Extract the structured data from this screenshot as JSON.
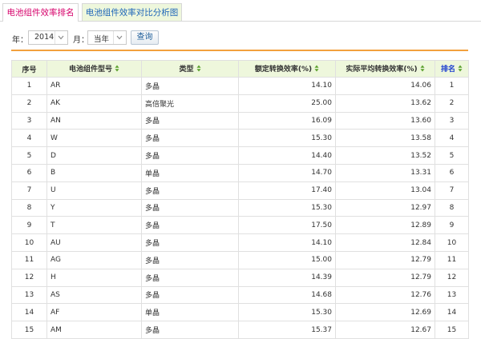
{
  "tabs": [
    {
      "label": "电池组件效率排名",
      "active": true
    },
    {
      "label": "电池组件效率对比分析图",
      "active": false
    }
  ],
  "filters": {
    "year_label": "年：",
    "year_value": "2014",
    "month_label": "月：",
    "month_value": "当年",
    "query_label": "查询"
  },
  "table": {
    "headers": {
      "seq": "序号",
      "model": "电池组件型号",
      "type": "类型",
      "rated": "额定转换效率(%)",
      "actual": "实际平均转换效率(%)",
      "rank": "排名"
    },
    "rows": [
      {
        "seq": "1",
        "model": "AR",
        "type": "多晶",
        "rated": "14.10",
        "actual": "14.06",
        "rank": "1"
      },
      {
        "seq": "2",
        "model": "AK",
        "type": "高倍聚光",
        "rated": "25.00",
        "actual": "13.62",
        "rank": "2"
      },
      {
        "seq": "3",
        "model": "AN",
        "type": "多晶",
        "rated": "16.09",
        "actual": "13.60",
        "rank": "3"
      },
      {
        "seq": "4",
        "model": "W",
        "type": "多晶",
        "rated": "15.30",
        "actual": "13.58",
        "rank": "4"
      },
      {
        "seq": "5",
        "model": "D",
        "type": "多晶",
        "rated": "14.40",
        "actual": "13.52",
        "rank": "5"
      },
      {
        "seq": "6",
        "model": "B",
        "type": "单晶",
        "rated": "14.70",
        "actual": "13.31",
        "rank": "6"
      },
      {
        "seq": "7",
        "model": "U",
        "type": "多晶",
        "rated": "17.40",
        "actual": "13.04",
        "rank": "7"
      },
      {
        "seq": "8",
        "model": "Y",
        "type": "多晶",
        "rated": "15.30",
        "actual": "12.97",
        "rank": "8"
      },
      {
        "seq": "9",
        "model": "T",
        "type": "多晶",
        "rated": "17.50",
        "actual": "12.89",
        "rank": "9"
      },
      {
        "seq": "10",
        "model": "AU",
        "type": "多晶",
        "rated": "14.10",
        "actual": "12.84",
        "rank": "10"
      },
      {
        "seq": "11",
        "model": "AG",
        "type": "多晶",
        "rated": "15.00",
        "actual": "12.79",
        "rank": "11"
      },
      {
        "seq": "12",
        "model": "H",
        "type": "多晶",
        "rated": "14.39",
        "actual": "12.79",
        "rank": "12"
      },
      {
        "seq": "13",
        "model": "AS",
        "type": "多晶",
        "rated": "14.68",
        "actual": "12.76",
        "rank": "13"
      },
      {
        "seq": "14",
        "model": "AF",
        "type": "单晶",
        "rated": "15.30",
        "actual": "12.69",
        "rank": "14"
      },
      {
        "seq": "15",
        "model": "AM",
        "type": "多晶",
        "rated": "15.37",
        "actual": "12.67",
        "rank": "15"
      }
    ]
  },
  "icons": {
    "sort": "sort-icon",
    "dropdown": "chevron-down-icon"
  },
  "colors": {
    "active_tab_text": "#d6006a",
    "inactive_tab_text": "#1c64b8",
    "header_bg": "#eef7dc",
    "link": "#1c3fd0",
    "sort_icon": "#5aa02c",
    "divider": "#f2a03d"
  }
}
